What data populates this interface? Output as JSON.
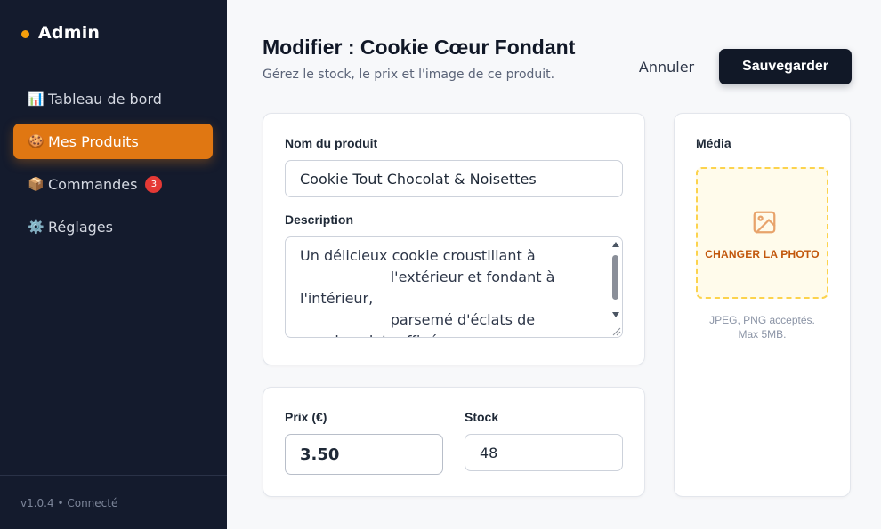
{
  "sidebar": {
    "brand": "Admin",
    "items": [
      {
        "emoji": "📊",
        "label": "Tableau de bord"
      },
      {
        "emoji": "🍪",
        "label": "Mes Produits"
      },
      {
        "emoji": "📦",
        "label": "Commandes",
        "badge": "3"
      },
      {
        "emoji": "⚙️",
        "label": "Réglages"
      }
    ],
    "active_index": 1,
    "footer": "v1.0.4 • Connecté"
  },
  "header": {
    "title": "Modifier : Cookie Cœur Fondant",
    "subtitle": "Gérez le stock, le prix et l'image de ce produit.",
    "cancel_label": "Annuler",
    "save_label": "Sauvegarder"
  },
  "form": {
    "name_label": "Nom du produit",
    "name_value": "Cookie Tout Chocolat & Noisettes",
    "description_label": "Description",
    "description_value": "Un délicieux cookie croustillant à\n                    l'extérieur et fondant à\nl'intérieur,\n                    parsemé d'éclats de\n      chocolat raffiné",
    "price_label": "Prix (€)",
    "price_value": "3.50",
    "stock_label": "Stock",
    "stock_value": "48"
  },
  "media": {
    "label": "Média",
    "cta": "CHANGER LA PHOTO",
    "icon": "image-icon",
    "hint_line1": "JPEG, PNG acceptés.",
    "hint_line2": "Max 5MB."
  },
  "colors": {
    "sidebar_bg": "#141b2d",
    "accent": "#e07712",
    "badge": "#e53935",
    "primary_button": "#111827",
    "dropzone_bg": "#fffbeb",
    "dropzone_border": "#fcd34d"
  }
}
